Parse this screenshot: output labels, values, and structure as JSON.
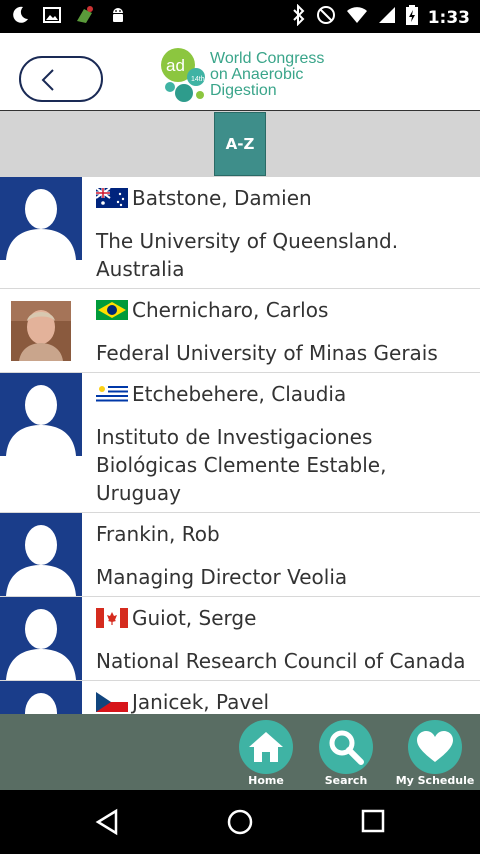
{
  "status_bar": {
    "time": "1:33",
    "left_icons": [
      "moon-icon",
      "image-icon",
      "game-icon",
      "android-icon"
    ],
    "right_icons": [
      "bluetooth-icon",
      "do-not-disturb-icon",
      "wifi-icon",
      "signal-icon",
      "battery-icon"
    ]
  },
  "header": {
    "logo": {
      "mark": "ad",
      "superscript": "14th",
      "line1": "World Congress",
      "line2": "on Anaerobic",
      "line3": "Digestion"
    }
  },
  "filter": {
    "az_label": "A-Z"
  },
  "speakers": [
    {
      "name": "Batstone, Damien",
      "org": "The University of Queensland. Australia",
      "flag": "australia",
      "avatar": "placeholder"
    },
    {
      "name": "Chernicharo, Carlos",
      "org": "Federal University of Minas Gerais",
      "flag": "brazil",
      "avatar": "photo"
    },
    {
      "name": "Etchebehere, Claudia",
      "org": "Instituto de Investigaciones Biológicas Clemente Estable, Uruguay",
      "flag": "uruguay",
      "avatar": "placeholder"
    },
    {
      "name": "Frankin, Rob",
      "org": "Managing Director Veolia",
      "flag": "",
      "avatar": "placeholder"
    },
    {
      "name": "Guiot, Serge",
      "org": "National Research Council of Canada",
      "flag": "canada",
      "avatar": "placeholder"
    },
    {
      "name": "Janicek, Pavel",
      "org": "",
      "flag": "czech",
      "avatar": "placeholder"
    }
  ],
  "bottom_nav": {
    "home": "Home",
    "search": "Search",
    "my_schedule": "My Schedule"
  },
  "colors": {
    "avatar_bg": "#1a3d8a",
    "accent_teal": "#3fb3a4",
    "az_tab": "#3e8e8a",
    "nav_bg": "#596d63",
    "logo_green": "#3aa58a"
  }
}
